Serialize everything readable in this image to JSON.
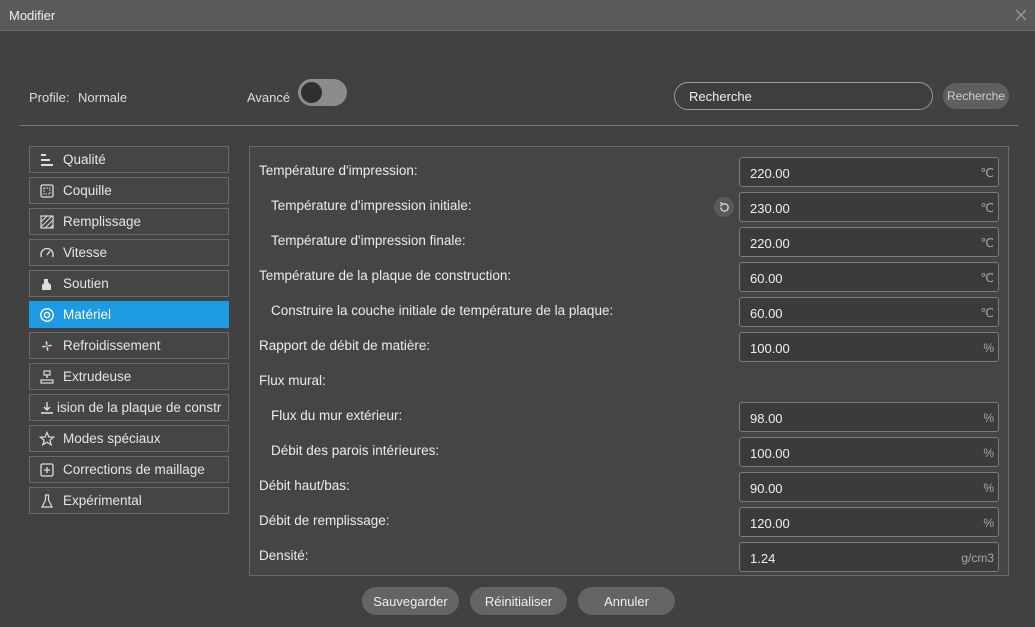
{
  "window": {
    "title": "Modifier"
  },
  "profile": {
    "label": "Profile:",
    "value": "Normale"
  },
  "advanced": {
    "label": "Avancé",
    "enabled": false
  },
  "search": {
    "value": "Recherche",
    "button_label": "Recherche"
  },
  "sidebar": {
    "items": [
      {
        "label": "Qualité",
        "icon": "quality-icon",
        "active": false
      },
      {
        "label": "Coquille",
        "icon": "shell-icon",
        "active": false
      },
      {
        "label": "Remplissage",
        "icon": "infill-icon",
        "active": false
      },
      {
        "label": "Vitesse",
        "icon": "speed-icon",
        "active": false
      },
      {
        "label": "Soutien",
        "icon": "support-icon",
        "active": false
      },
      {
        "label": "Matériel",
        "icon": "material-icon",
        "active": true
      },
      {
        "label": "Refroidissement",
        "icon": "fan-icon",
        "active": false
      },
      {
        "label": "Extrudeuse",
        "icon": "extruder-icon",
        "active": false
      },
      {
        "label": "ision de la plaque de constr",
        "icon": "bed-adhesion-icon",
        "active": false
      },
      {
        "label": "Modes spéciaux",
        "icon": "star-icon",
        "active": false
      },
      {
        "label": "Corrections de maillage",
        "icon": "mesh-fix-icon",
        "active": false
      },
      {
        "label": "Expérimental",
        "icon": "flask-icon",
        "active": false
      }
    ]
  },
  "settings": {
    "rows": [
      {
        "label": "Température d'impression:",
        "value": "220.00",
        "unit": "℃",
        "indent": false,
        "reset": false
      },
      {
        "label": "Température d'impression initiale:",
        "value": "230.00",
        "unit": "℃",
        "indent": true,
        "reset": true
      },
      {
        "label": "Température d'impression finale:",
        "value": "220.00",
        "unit": "℃",
        "indent": true,
        "reset": false
      },
      {
        "label": "Température de la plaque de construction:",
        "value": "60.00",
        "unit": "℃",
        "indent": false,
        "reset": false
      },
      {
        "label": "Construire la couche initiale de température de la plaque:",
        "value": "60.00",
        "unit": "℃",
        "indent": true,
        "reset": false
      },
      {
        "label": "Rapport de débit de matière:",
        "value": "100.00",
        "unit": "%",
        "indent": false,
        "reset": false
      },
      {
        "label": "Flux mural:",
        "value": null,
        "unit": null,
        "indent": false,
        "reset": false
      },
      {
        "label": "Flux du mur extérieur:",
        "value": "98.00",
        "unit": "%",
        "indent": true,
        "reset": false
      },
      {
        "label": "Débit des parois intérieures:",
        "value": "100.00",
        "unit": "%",
        "indent": true,
        "reset": false
      },
      {
        "label": "Débit haut/bas:",
        "value": "90.00",
        "unit": "%",
        "indent": false,
        "reset": false
      },
      {
        "label": "Débit de remplissage:",
        "value": "120.00",
        "unit": "%",
        "indent": false,
        "reset": false
      },
      {
        "label": "Densité:",
        "value": "1.24",
        "unit": "g/cm3",
        "indent": false,
        "reset": false
      }
    ]
  },
  "footer": {
    "save_label": "Sauvegarder",
    "reset_label": "Réinitialiser",
    "cancel_label": "Annuler"
  },
  "colors": {
    "accent": "#1e9ae5",
    "background": "#414141",
    "panel": "#454545"
  }
}
